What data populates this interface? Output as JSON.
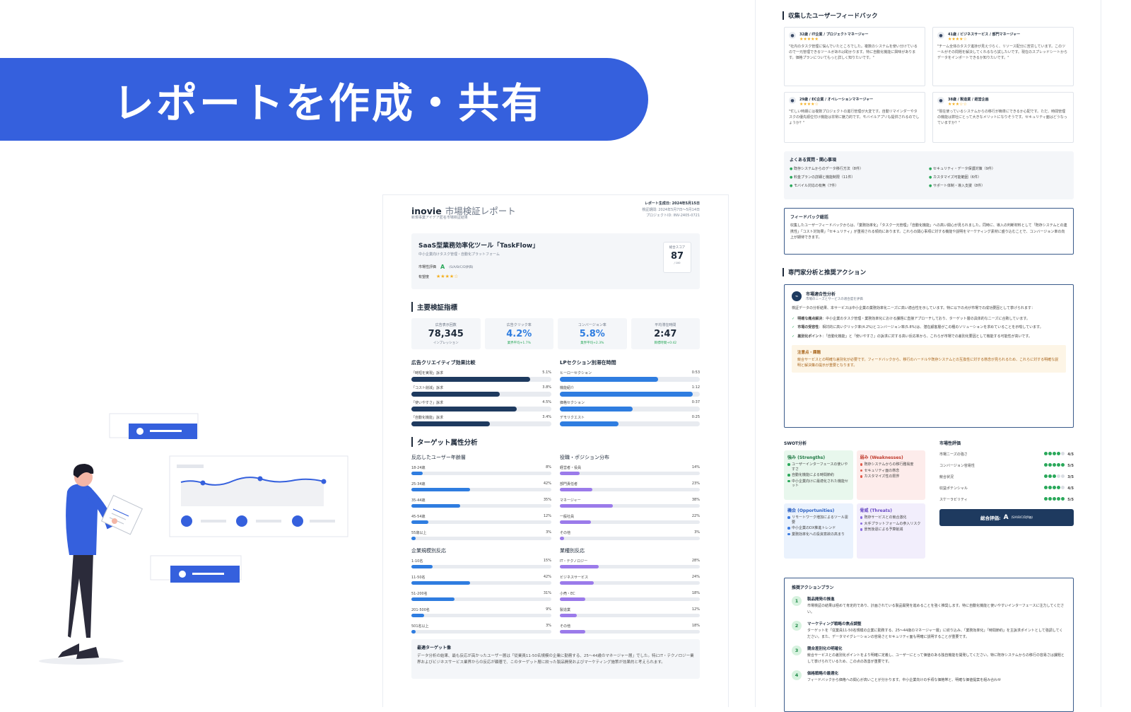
{
  "banner": {
    "title": "レポートを作成・共有"
  },
  "colors": {
    "brand_blue": "#3560dd",
    "navy": "#1e3a5f",
    "bar_blue": "#2f7de0",
    "bar_purple": "#9b7bea",
    "green": "#2aa85a",
    "star": "#f5b020"
  },
  "report": {
    "brand": "inovie",
    "title_rest": "市場検証レポート",
    "subtitle": "新規事業アイデア匿名市場検証結果",
    "generated": "レポート生成日: 2024年5月15日",
    "period": "検証期間: 2024年5月7日〜5月14日",
    "project_id": "プロジェクトID: INV-2405-0721",
    "product": {
      "name": "SaaS型業務効率化ツール「TaskFlow」",
      "desc": "中小企業向けタスク管理・自動化プラットフォーム",
      "rating_label": "市場性評価",
      "rating_value": "A",
      "rating_note": "(S/A/B/C/D評価)",
      "prospect_label": "有望度",
      "prospect_stars": "★★★★☆",
      "score_label": "総合スコア",
      "score_value": "87",
      "score_max": "/ 100"
    },
    "kpi_title": "主要検証指標",
    "kpis": [
      {
        "label": "広告表示回数",
        "value": "78,345",
        "sub": "インプレッション"
      },
      {
        "label": "広告クリック率",
        "value": "4.2%",
        "sub": "業界平均+1.7%"
      },
      {
        "label": "コンバージョン率",
        "value": "5.8%",
        "sub": "業界平均+2.3%"
      },
      {
        "label": "平均滞在時間",
        "value": "2:47",
        "sub": "目標時間+0:42"
      }
    ],
    "ad_compare": {
      "title": "広告クリエイティブ効果比較",
      "items": [
        {
          "label": "「時短を実現」訴求",
          "value": "5.1%",
          "pct": 0.85
        },
        {
          "label": "「コスト削減」訴求",
          "value": "3.8%",
          "pct": 0.63
        },
        {
          "label": "「使いやすさ」訴求",
          "value": "4.5%",
          "pct": 0.75
        },
        {
          "label": "「自動化機能」訴求",
          "value": "3.4%",
          "pct": 0.56
        }
      ]
    },
    "lp_time": {
      "title": "LPセクション別滞在時間",
      "items": [
        {
          "label": "ヒーローセクション",
          "value": "0:53",
          "pct": 0.7
        },
        {
          "label": "機能紹介",
          "value": "1:12",
          "pct": 0.95
        },
        {
          "label": "価格セクション",
          "value": "0:37",
          "pct": 0.52
        },
        {
          "label": "デモリクエスト",
          "value": "0:25",
          "pct": 0.42
        }
      ]
    },
    "target_title": "ターゲット属性分析",
    "age": {
      "title": "反応したユーザー年齢層",
      "items": [
        {
          "label": "18-24歳",
          "value": "8%",
          "pct": 0.08
        },
        {
          "label": "25-34歳",
          "value": "42%",
          "pct": 0.42
        },
        {
          "label": "35-44歳",
          "value": "35%",
          "pct": 0.35
        },
        {
          "label": "45-54歳",
          "value": "12%",
          "pct": 0.12
        },
        {
          "label": "55歳以上",
          "value": "3%",
          "pct": 0.03
        }
      ]
    },
    "role": {
      "title": "役職・ポジション分布",
      "items": [
        {
          "label": "経営者・役員",
          "value": "14%",
          "pct": 0.14
        },
        {
          "label": "部門責任者",
          "value": "23%",
          "pct": 0.23
        },
        {
          "label": "マネージャー",
          "value": "38%",
          "pct": 0.38
        },
        {
          "label": "一般社員",
          "value": "22%",
          "pct": 0.22
        },
        {
          "label": "その他",
          "value": "3%",
          "pct": 0.03
        }
      ]
    },
    "company": {
      "title": "企業規模別反応",
      "items": [
        {
          "label": "1-10名",
          "value": "15%",
          "pct": 0.15
        },
        {
          "label": "11-50名",
          "value": "42%",
          "pct": 0.42
        },
        {
          "label": "51-200名",
          "value": "31%",
          "pct": 0.31
        },
        {
          "label": "201-500名",
          "value": "9%",
          "pct": 0.09
        },
        {
          "label": "501名以上",
          "value": "3%",
          "pct": 0.03
        }
      ]
    },
    "industry": {
      "title": "業種別反応",
      "items": [
        {
          "label": "IT・テクノロジー",
          "value": "28%",
          "pct": 0.28
        },
        {
          "label": "ビジネスサービス",
          "value": "24%",
          "pct": 0.24
        },
        {
          "label": "小売・EC",
          "value": "18%",
          "pct": 0.18
        },
        {
          "label": "製造業",
          "value": "12%",
          "pct": 0.12
        },
        {
          "label": "その他",
          "value": "18%",
          "pct": 0.18
        }
      ]
    },
    "best_target": {
      "title": "最適ターゲット像",
      "body": "データ分析の結果、最も反応が高かったユーザー層は「従業員11-50名規模の企業に勤務する、25〜44歳のマネージャー層」でした。特にIT・テクノロジー業界およびビジネスサービス業界からの反応が顕著で、このターゲット層に絞った製品開発およびマーケティング施策が効果的と考えられます。"
    }
  },
  "feedback": {
    "title": "収集したユーザーフィードバック",
    "items": [
      {
        "who": "32歳 / IT企業 / プロジェクトマネージャー",
        "stars": "★★★★★",
        "text": "\"社内のタスク管理に悩んでいたところでした。複数のシステムを使い分けているので一元管理できるツールがあれば助かります。特に自動化機能に興味があります。価格プランについてもっと詳しく知りたいです。\""
      },
      {
        "who": "41歳 / ビジネスサービス / 部門マネージャー",
        "stars": "★★★★☆",
        "text": "\"チーム全体のタスク進捗が見えづらく、リソース配分に苦労しています。このツールがその問題を解決してくれるなら試したいです。現在のスプレッドシートからデータをインポートできるか知りたいです。\""
      },
      {
        "who": "29歳 / EC企業 / オペレーションマネージャー",
        "stars": "★★★★☆",
        "text": "\"忙しい時期には複数プロジェクトの進行管理が大変です。自動リマインダーやタスクの優先順位付け機能は非常に魅力的です。モバイルアプリも提供されるのでしょうか？\""
      },
      {
        "who": "38歳 / 製造業 / 経営企画",
        "stars": "★★★☆☆",
        "text": "\"現在使っているシステムからの移行が簡単にできるか心配です。ただ、時間管理の機能は弊社にとって大きなメリットになりそうです。セキュリティ面はどうなっていますか？\""
      }
    ]
  },
  "faq": {
    "title": "よくある質問・関心事項",
    "items": [
      "既存システムからのデータ移行方法（8件）",
      "セキュリティ・データ保護対策（9件）",
      "料金プランの詳細と機能制限（11件）",
      "カスタマイズ可能範囲（6件）",
      "モバイル対応の有無（7件）",
      "サポート体制・導入支援（8件）"
    ]
  },
  "summary": {
    "title": "フィードバック総括",
    "body": "収集したユーザーフィードバックからは、「業務効率化」「タスク一元管理」「自動化機能」への高い関心が見られました。同時に、導入の判断材料として「既存システムとの連携性」「コスト対効果」「セキュリティ」が重視される傾向にあります。これらの関心事項に対する機能や説明をマーケティング素材に盛り込むことで、コンバージョン率の向上が期待できます。"
  },
  "expert": {
    "title": "専門家分析と推奨アクション",
    "fit_title": "市場適合性分析",
    "fit_sub": "市場のニーズとサービスの適合度を評価",
    "fit_intro": "検証データの分析結果、本サービスは中小企業の業務効率化ニーズに高い適合性を示しています。特に以下の点が市場での成功要因として挙げられます：",
    "points": [
      {
        "bold": "明確な痛点解決",
        "text": "：中小企業のタスク管理・業務効率化における課題に直接アプローチしており、ターゲット層の具体的なニーズに合致しています。"
      },
      {
        "bold": "市場の受容性",
        "text": "：相対的に高いクリック率(4.2%)とコンバージョン率(5.8%)は、潜在顧客層がこの種のソリューションを求めていることを示唆しています。"
      },
      {
        "bold": "差別化ポイント",
        "text": "：「自動化機能」と「使いやすさ」の訴求に対する高い反応率から、これらが市場での差別化要因として機能する可能性が高いです。"
      }
    ],
    "warn_title": "注意点・課題",
    "warn_body": "競合サービスとの明確な差別化が必要です。フィードバックから、移行のハードルや既存システムとの互換性に対する懸念が見られるため、これらに対する明確な説明と解決策の提示が重要となります。"
  },
  "swot": {
    "title": "SWOT分析",
    "s_title": "強み (Strengths)",
    "s": [
      "ユーザーインターフェースの使いやすさ",
      "自動化機能による時間節約",
      "中小企業向けに最適化された機能セット"
    ],
    "w_title": "弱み (Weaknesses)",
    "w": [
      "既存システムからの移行難易度",
      "セキュリティ面の懸念",
      "カスタマイズ性の限界"
    ],
    "o_title": "機会 (Opportunities)",
    "o": [
      "リモートワーク増加によるツール需要",
      "中小企業のDX推進トレンド",
      "業務効率化への投資意欲の高まり"
    ],
    "t_title": "脅威 (Threats)",
    "t": [
      "既存サービスとの競合激化",
      "大手プラットフォームの参入リスク",
      "景気後退による予算削減"
    ]
  },
  "market_eval": {
    "title": "市場性評価",
    "items": [
      {
        "label": "市場ニーズの強さ",
        "score": 4,
        "value": "4/5"
      },
      {
        "label": "コンバージョン容易性",
        "score": 5,
        "value": "5/5"
      },
      {
        "label": "競合状況",
        "score": 3,
        "value": "3/5"
      },
      {
        "label": "収益ポテンシャル",
        "score": 4,
        "value": "4/5"
      },
      {
        "label": "スケーラビリティ",
        "score": 5,
        "value": "5/5"
      }
    ],
    "overall_label": "総合評価:",
    "overall_value": "A",
    "overall_note": "(S/A/B/C/D評価)"
  },
  "actions": {
    "title": "推奨アクションプラン",
    "items": [
      {
        "num": "1",
        "title": "製品開発の推進",
        "body": "市場検証の結果は極めて肯定的であり、計画されている製品開発を進めることを強く推奨します。特に自動化機能と使いやすいインターフェースに注力してください。"
      },
      {
        "num": "2",
        "title": "マーケティング戦略の焦点調整",
        "body": "ターゲットを「従業員11-50名規模の企業に勤務する、25〜44歳のマネージャー層」に絞り込み、「業務効率化」「時間節約」を主訴求ポイントとして強調してください。また、データマイグレーションの容易さとセキュリティ面も明確に説明することが重要です。"
      },
      {
        "num": "3",
        "title": "競合差別化の明確化",
        "body": "競合サービスとの差別化ポイントをより明確に定義し、ユーザーにとって価値のある独自機能を開発してください。特に既存システムからの移行の容易さは課題として挙げられているため、この点の改善が重要です。"
      },
      {
        "num": "4",
        "title": "価格戦略の最適化",
        "body": "フィードバックから価格への関心が高いことが分かります。中小企業向けの手頃な価格帯と、明確な価値提案を組み合わせ"
      }
    ]
  }
}
